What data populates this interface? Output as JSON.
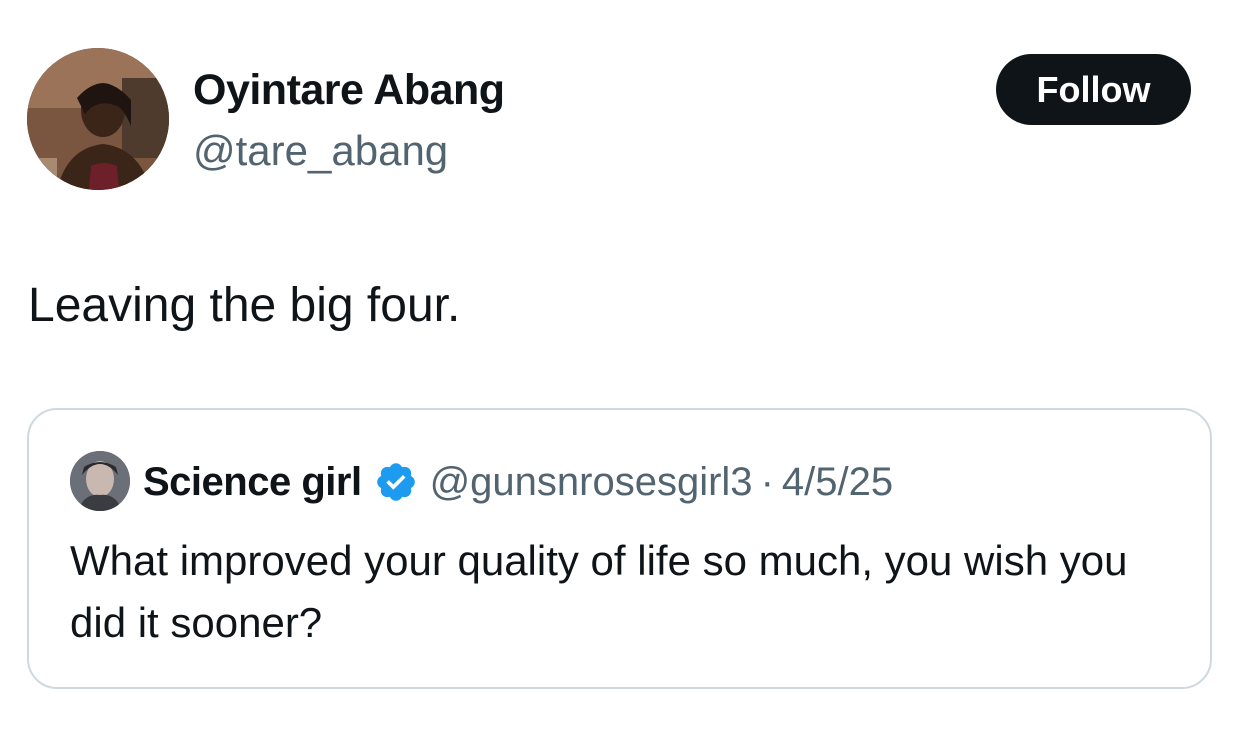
{
  "author": {
    "name": "Oyintare Abang",
    "handle": "@tare_abang",
    "avatar_icon": "profile-photo"
  },
  "follow_button": {
    "label": "Follow",
    "color": "#0f1419"
  },
  "tweet": {
    "text": "Leaving the big four."
  },
  "quoted_tweet": {
    "author_name": "Science girl",
    "verified": true,
    "verified_color": "#1d9bf0",
    "handle": "@gunsnrosesgirl3",
    "separator": "·",
    "date": "4/5/25",
    "text": "What improved your quality of life so much, you wish you did it sooner?"
  }
}
